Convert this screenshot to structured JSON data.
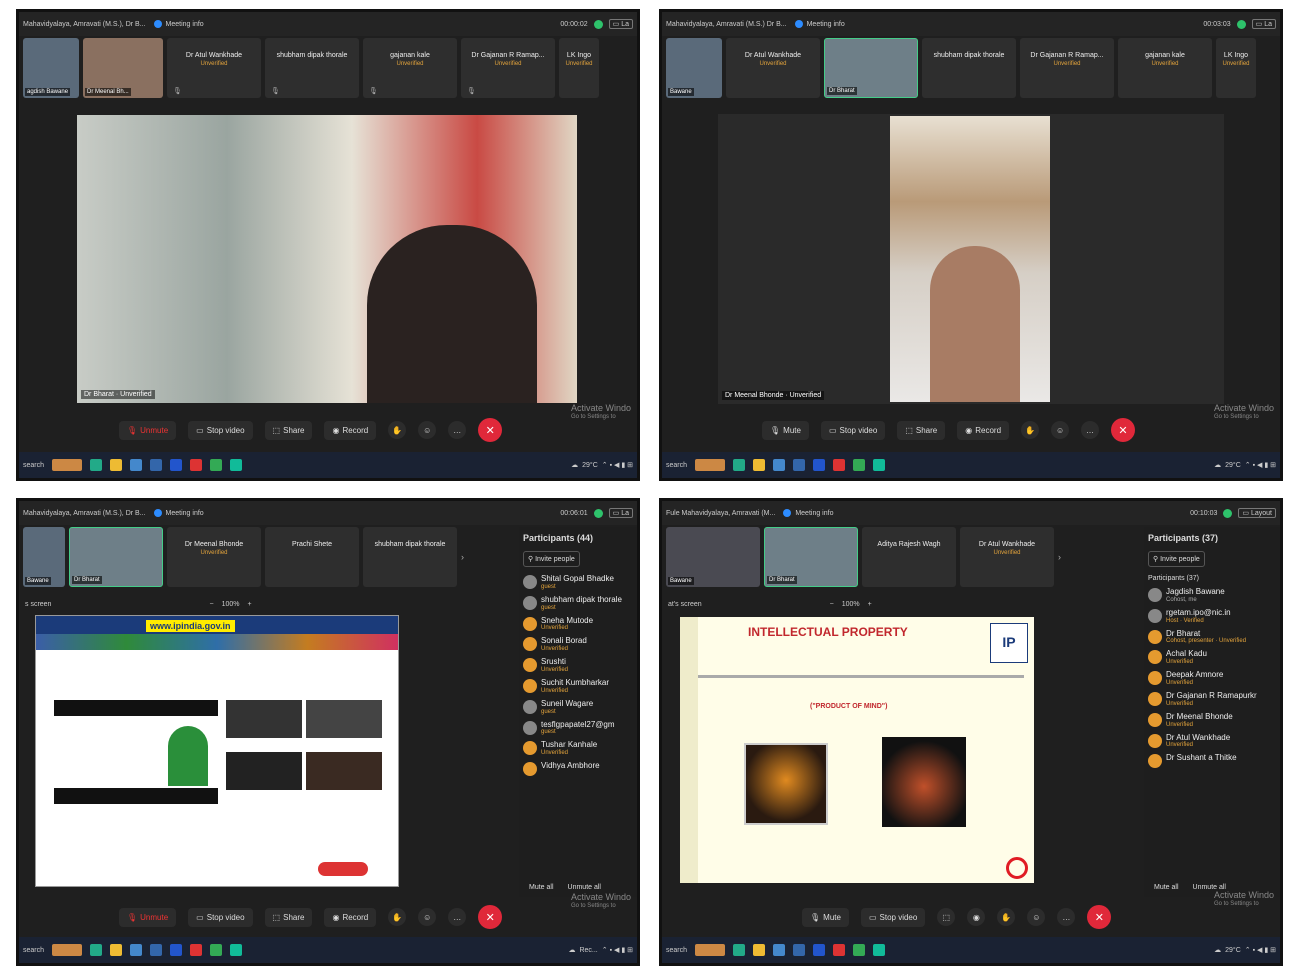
{
  "shots": [
    {
      "title": "Mahavidyalaya, Amravati (M.S.), Dr B...",
      "meeting_info": "Meeting info",
      "timer": "00:00:02",
      "strip": [
        {
          "name": "agdish Bawane",
          "cam": true
        },
        {
          "name": "Dr Meenal Bh...",
          "cam": true
        },
        {
          "name": "Dr Atul Wankhade",
          "sub": "Unverified"
        },
        {
          "name": "shubham dipak thorale",
          "sub": ""
        },
        {
          "name": "gajanan kale",
          "sub": "Unverified"
        },
        {
          "name": "Dr Gajanan R Ramap...",
          "sub": "Unverified"
        },
        {
          "name": "LK Ingo",
          "sub": "Unverified"
        }
      ],
      "speaker": "Dr Bharat · Unverified",
      "controls": [
        "Unmute",
        "Stop video",
        "Share",
        "Record"
      ],
      "watermark": "Activate Windo",
      "watermark_sub": "Go to Settings to",
      "search": "search",
      "weather": "29°C"
    },
    {
      "title": "Mahavidyalaya, Amravati (M.S.) Dr B...",
      "meeting_info": "Meeting info",
      "timer": "00:03:03",
      "strip": [
        {
          "name": "Bawane",
          "cam": true
        },
        {
          "name": "Dr Atul Wankhade",
          "sub": "Unverified"
        },
        {
          "name": "Dr Bharat",
          "cam": true
        },
        {
          "name": "shubham dipak thorale",
          "sub": ""
        },
        {
          "name": "Dr Gajanan R Ramap...",
          "sub": "Unverified"
        },
        {
          "name": "gajanan kale",
          "sub": "Unverified"
        },
        {
          "name": "LK Ingo",
          "sub": "Unverified"
        }
      ],
      "speaker": "Dr Meenal Bhonde · Unverified",
      "controls": [
        "Mute",
        "Stop video",
        "Share",
        "Record"
      ],
      "watermark": "Activate Windo",
      "watermark_sub": "Go to Settings to",
      "search": "search",
      "weather": "29°C"
    },
    {
      "title": "Mahavidyalaya, Amravati (M.S.), Dr B...",
      "meeting_info": "Meeting info",
      "timer": "00:06:01",
      "strip": [
        {
          "name": "Bawane",
          "cam": true
        },
        {
          "name": "Dr Bharat",
          "cam": true
        },
        {
          "name": "Dr Meenal Bhonde",
          "sub": "Unverified"
        },
        {
          "name": "Prachi Shete",
          "sub": ""
        },
        {
          "name": "shubham dipak thorale",
          "sub": ""
        }
      ],
      "share_label": "s screen",
      "zoom": "100%",
      "site_url": "www.ipindia.gov.in",
      "participants_title": "Participants (44)",
      "invite": "Invite people",
      "participants": [
        {
          "name": "Shital Gopal Bhadke",
          "sub": "guest"
        },
        {
          "name": "shubham dipak thorale",
          "sub": "guest"
        },
        {
          "name": "Sneha Mutode",
          "sub": "Unverified"
        },
        {
          "name": "Sonali Borad",
          "sub": "Unverified"
        },
        {
          "name": "Srushti",
          "sub": "Unverified"
        },
        {
          "name": "Suchit Kumbharkar",
          "sub": "Unverified"
        },
        {
          "name": "Suneil Wagare",
          "sub": "guest"
        },
        {
          "name": "tesflgpapatel27@gm",
          "sub": "guest"
        },
        {
          "name": "Tushar Kanhale",
          "sub": "Unverified"
        },
        {
          "name": "Vidhya Ambhore",
          "sub": ""
        }
      ],
      "mute_all": "Mute all",
      "unmute_all": "Unmute all",
      "controls": [
        "Unmute",
        "Stop video",
        "Share",
        "Record"
      ],
      "watermark": "Activate Windo",
      "watermark_sub": "Go to Settings to",
      "search": "search",
      "weather": "Rec..."
    },
    {
      "title": "Fule Mahavidyalaya, Amravati (M...",
      "meeting_info": "Meeting info",
      "timer": "00:10:03",
      "layout": "Layout",
      "strip": [
        {
          "name": "Bawane",
          "cam": true
        },
        {
          "name": "Dr Bharat",
          "cam": true
        },
        {
          "name": "Aditya Rajesh Wagh",
          "sub": ""
        },
        {
          "name": "Dr Atul Wankhade",
          "sub": "Unverified"
        }
      ],
      "share_label": "at's screen",
      "zoom": "100%",
      "slide_title": "INTELLECTUAL PROPERTY",
      "slide_sub": "(\"PRODUCT OF MIND\")",
      "participants_title": "Participants (37)",
      "invite": "Invite people",
      "group": "Participants (37)",
      "participants": [
        {
          "name": "Jagdish Bawane",
          "sub": "Cohost, me"
        },
        {
          "name": "rgetam.ipo@nic.in",
          "sub": "Host · Verified"
        },
        {
          "name": "Dr Bharat",
          "sub": "Cohost, presenter · Unverified"
        },
        {
          "name": "Achal Kadu",
          "sub": "Unverified"
        },
        {
          "name": "Deepak Amnore",
          "sub": "Unverified"
        },
        {
          "name": "Dr Gajanan R Ramapurkr",
          "sub": "Unverified"
        },
        {
          "name": "Dr Meenal Bhonde",
          "sub": "Unverified"
        },
        {
          "name": "Dr Atul Wankhade",
          "sub": "Unverified"
        },
        {
          "name": "Dr Sushant a Thitke",
          "sub": ""
        }
      ],
      "mute_all": "Mute all",
      "unmute_all": "Unmute all",
      "controls": [
        "Mute",
        "Stop video"
      ],
      "watermark": "Activate Windo",
      "watermark_sub": "Go to Settings to",
      "search": "search",
      "weather": "29°C"
    }
  ]
}
